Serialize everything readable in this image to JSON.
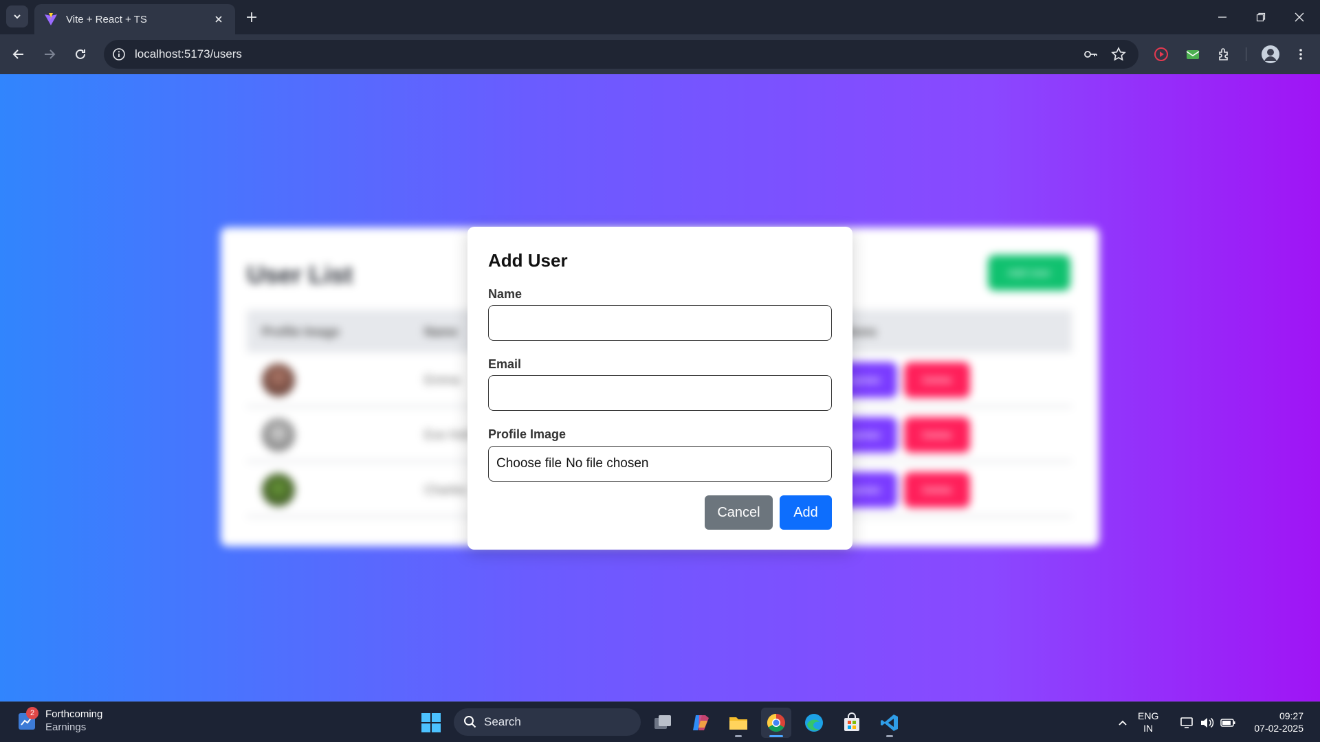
{
  "browser": {
    "tab_title": "Vite + React + TS",
    "url": "localhost:5173/users"
  },
  "background_page": {
    "title": "User List",
    "add_button": "Add User",
    "columns": [
      "Profile Image",
      "Name",
      "Actions"
    ],
    "rows": [
      {
        "name": "Emma"
      },
      {
        "name": "Eve Holt"
      },
      {
        "name": "Charles"
      }
    ],
    "update_label": "Update",
    "delete_label": "Delete"
  },
  "modal": {
    "title": "Add User",
    "name_label": "Name",
    "name_value": "",
    "email_label": "Email",
    "email_value": "",
    "image_label": "Profile Image",
    "file_button": "Choose file",
    "file_status": "No file chosen",
    "cancel_label": "Cancel",
    "add_label": "Add"
  },
  "taskbar": {
    "widget_badge": "2",
    "widget_title": "Forthcoming",
    "widget_subtitle": "Earnings",
    "search_label": "Search",
    "lang_top": "ENG",
    "lang_bottom": "IN",
    "time": "09:27",
    "date": "07-02-2025"
  },
  "colors": {
    "page_gradient_start": "#3185fd",
    "page_gradient_end": "#a014f5",
    "add_button": "#0d6efd",
    "cancel_button": "#6c757d",
    "bg_add_user": "#10c16f",
    "bg_update": "#7a3bff",
    "bg_delete": "#ff1f5a"
  }
}
